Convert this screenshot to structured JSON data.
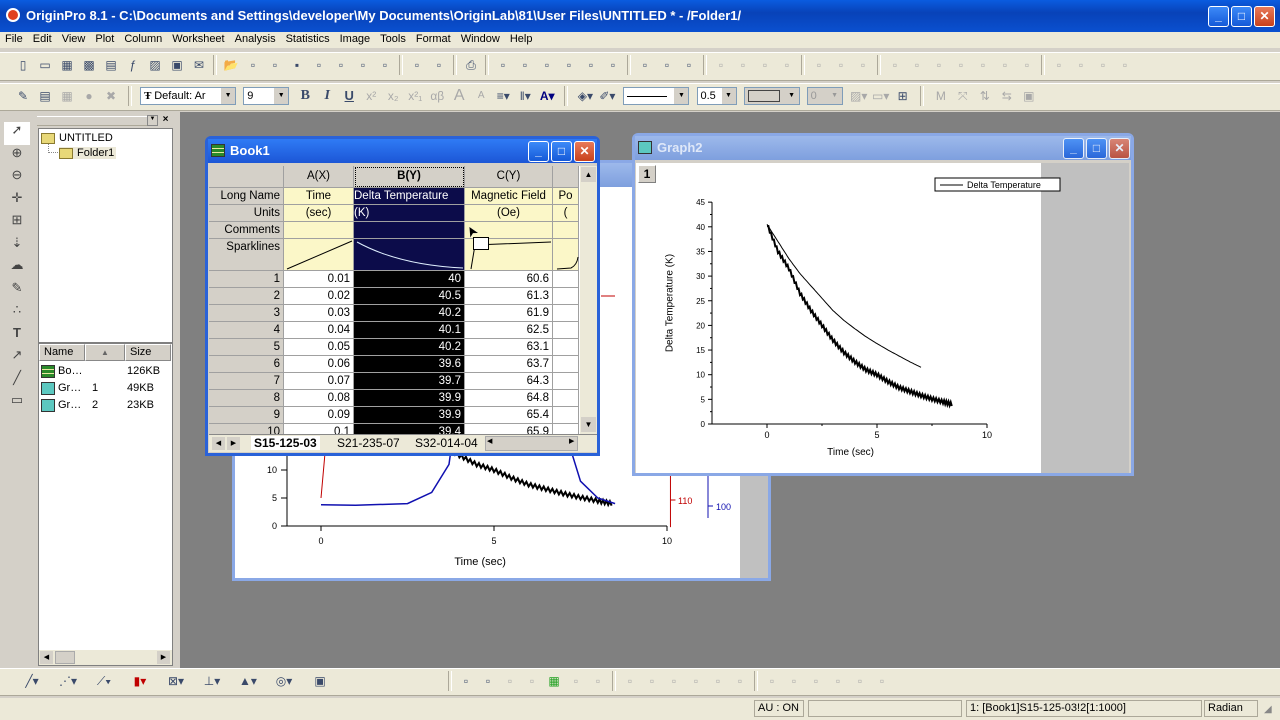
{
  "app": {
    "title": "OriginPro 8.1 - C:\\Documents and Settings\\developer\\My Documents\\OriginLab\\81\\User Files\\UNTITLED * - /Folder1/"
  },
  "menu": [
    "File",
    "Edit",
    "View",
    "Plot",
    "Column",
    "Worksheet",
    "Analysis",
    "Statistics",
    "Image",
    "Tools",
    "Format",
    "Window",
    "Help"
  ],
  "toolbar1": [
    "new-project",
    "new-folder",
    "new-worksheet",
    "new-excel",
    "new-matrix",
    "new-function",
    "new-graph",
    "new-layout",
    "new-notes",
    "open",
    "open-template",
    "open-excel",
    "save",
    "save-template",
    "import-ascii",
    "import-multiple",
    "import-wizard",
    "duplicate",
    "refresh",
    "print",
    "recalculate",
    "column-values",
    "organizer",
    "code-builder",
    "results-log",
    "command-window",
    "project-explorer",
    "script-window",
    "add-data"
  ],
  "toolbar1_disabled": [
    "zoom-in",
    "zoom-out",
    "whole-page",
    "rescale",
    "layer-1",
    "layer-2",
    "layer-3",
    "axis-1",
    "axis-2",
    "axis-3",
    "axis-4",
    "axis-5",
    "axis-6",
    "axis-7",
    "layers",
    "table",
    "timer",
    "grid"
  ],
  "toolbar2": {
    "font_name": "Default: Ar",
    "font_size": "9",
    "bold": "B",
    "italic": "I",
    "underline": "U",
    "superscript": "x²",
    "subscript": "x₂",
    "supsub": "x²₁",
    "greek": "αβ",
    "larger": "A",
    "smaller": "A",
    "line_width": "0.5",
    "pattern_value": "0"
  },
  "left_tools": [
    "pointer-icon",
    "zoom-in-icon",
    "zoom-out-icon",
    "screen-reader-icon",
    "data-selector-icon",
    "data-reader-icon",
    "mask-icon",
    "draw-data-icon",
    "regional-mask-icon",
    "text-tool-icon",
    "arrow-tool-icon",
    "line-tool-icon",
    "rectangle-tool-icon"
  ],
  "explorer": {
    "root": "UNTITLED",
    "folder": "Folder1",
    "columns": [
      "Name",
      "Size"
    ],
    "items": [
      {
        "name": "Bo…",
        "num": "",
        "size": "126KB",
        "type": "workbook"
      },
      {
        "name": "Gr…",
        "num": "1",
        "size": "49KB",
        "type": "graph"
      },
      {
        "name": "Gr…",
        "num": "2",
        "size": "23KB",
        "type": "graph"
      }
    ]
  },
  "book1": {
    "title": "Book1",
    "columns": [
      {
        "id": "A(X)"
      },
      {
        "id": "B(Y)"
      },
      {
        "id": "C(Y)"
      },
      {
        "id": ""
      }
    ],
    "meta_labels": [
      "Long Name",
      "Units",
      "Comments",
      "Sparklines"
    ],
    "long_names": [
      "Time",
      "Delta Temperature",
      "Magnetic Field",
      "Po"
    ],
    "units": [
      "(sec)",
      "(K)",
      "(Oe)",
      "("
    ],
    "rows": [
      [
        "1",
        "0.01",
        "40",
        "60.6"
      ],
      [
        "2",
        "0.02",
        "40.5",
        "61.3"
      ],
      [
        "3",
        "0.03",
        "40.2",
        "61.9"
      ],
      [
        "4",
        "0.04",
        "40.1",
        "62.5"
      ],
      [
        "5",
        "0.05",
        "40.2",
        "63.1"
      ],
      [
        "6",
        "0.06",
        "39.6",
        "63.7"
      ],
      [
        "7",
        "0.07",
        "39.7",
        "64.3"
      ],
      [
        "8",
        "0.08",
        "39.9",
        "64.8"
      ],
      [
        "9",
        "0.09",
        "39.9",
        "65.4"
      ],
      [
        "10",
        "0.1",
        "39.4",
        "65.9"
      ]
    ],
    "sheets": [
      "S15-125-03",
      "S21-235-07",
      "S32-014-04"
    ]
  },
  "graph1": {
    "x_ticks": [
      "0",
      "5",
      "10"
    ],
    "y_ticks": [
      "0",
      "5",
      "10"
    ],
    "xlabel": "Time (sec)",
    "right_red_tick": "110",
    "right_blue_tick": "100",
    "colors": {
      "black": "#000000",
      "red": "#c00000",
      "blue": "#1010b0"
    }
  },
  "chart_data": {
    "type": "line",
    "title": "",
    "layer_label": "1",
    "xlabel": "Time (sec)",
    "ylabel": "Delta Temperature (K)",
    "xlim": [
      -2.5,
      10
    ],
    "ylim": [
      0,
      45
    ],
    "x_ticks": [
      "0",
      "5",
      "10"
    ],
    "y_ticks": [
      "0",
      "5",
      "10",
      "15",
      "20",
      "25",
      "30",
      "35",
      "40",
      "45"
    ],
    "legend": {
      "entries": [
        "Delta Temperature"
      ],
      "placement": "top-right"
    },
    "series": [
      {
        "name": "Delta Temperature (data)",
        "x": [
          0,
          0.5,
          1,
          1.5,
          2,
          2.5,
          3,
          3.5,
          4,
          4.5,
          5,
          5.5,
          6,
          6.5,
          7,
          7.5,
          8,
          8.4
        ],
        "y": [
          40.5,
          35,
          31.5,
          26.5,
          23,
          20,
          17,
          14.5,
          12.6,
          11,
          10,
          8.6,
          7.4,
          6.6,
          5.8,
          5.1,
          4.5,
          4
        ]
      },
      {
        "name": "Delta Temperature (fit)",
        "x": [
          0,
          0.5,
          1,
          1.5,
          2,
          2.5,
          3,
          3.5,
          4,
          4.5,
          5,
          5.5,
          6,
          6.5,
          7
        ],
        "y": [
          40.5,
          37,
          33.5,
          30.5,
          28,
          25.5,
          23,
          21,
          19.3,
          17.7,
          16.3,
          15,
          13.8,
          12.6,
          11.5
        ]
      }
    ]
  },
  "graph2": {
    "title": "Graph2"
  },
  "status": {
    "au": "AU : ON",
    "blank": "",
    "cell": "1: [Book1]S15-125-03!2[1:1000]",
    "angle": "Radian"
  },
  "bottom_toolbar": [
    "line-plot",
    "scatter-plot",
    "line-symbol-plot",
    "column-plot",
    "contour-plot",
    "box-plot",
    "3d-surface-plot",
    "polar-plot",
    "template-library"
  ],
  "bottom_toolbar2": [
    "merge-graphs",
    "new-layer",
    "group",
    "ungroup",
    "color-map",
    "image-plot",
    "waterfall",
    "align-left",
    "align-center",
    "align-right",
    "align-top",
    "align-middle",
    "align-bottom",
    "same-width",
    "same-height",
    "bring-front",
    "send-back",
    "group-objects",
    "ungroup-objects"
  ]
}
